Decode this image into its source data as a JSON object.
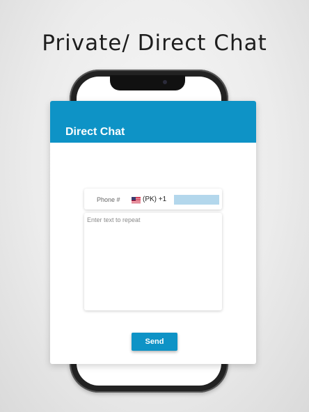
{
  "headline": "Private/ Direct Chat",
  "app": {
    "title": "Direct Chat",
    "accent_color": "#0e93c6"
  },
  "phone_field": {
    "label": "Phone #",
    "flag_icon": "us-flag-icon",
    "country_code": "(PK) +1",
    "value": ""
  },
  "message": {
    "placeholder": "Enter text to repeat",
    "value": ""
  },
  "send_label": "Send"
}
